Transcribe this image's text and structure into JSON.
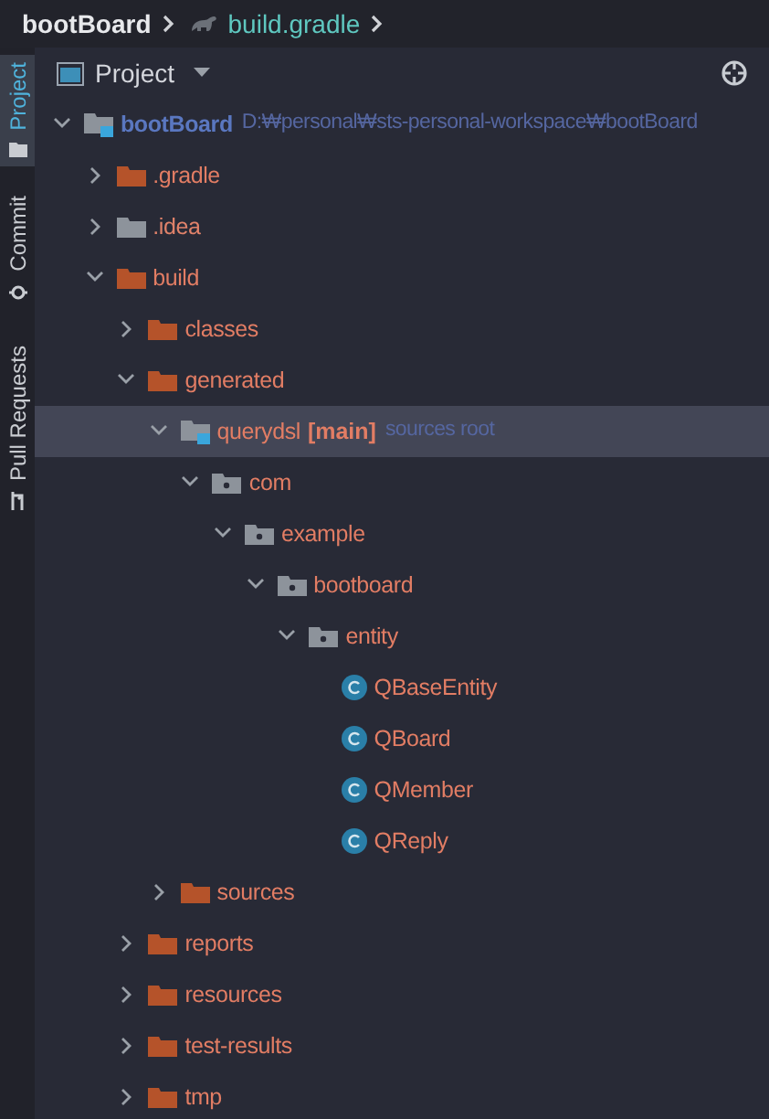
{
  "breadcrumbs": [
    {
      "label": "bootBoard",
      "kind": "project"
    },
    {
      "label": "build.gradle",
      "kind": "gradle"
    }
  ],
  "side_tabs": [
    {
      "label": "Project",
      "kind": "folder",
      "selected": true
    },
    {
      "label": "Commit",
      "kind": "commit",
      "selected": false
    },
    {
      "label": "Pull Requests",
      "kind": "pull",
      "selected": false
    }
  ],
  "panel": {
    "title": "Project"
  },
  "tree": [
    {
      "label": "bootBoard",
      "hint": "D:₩personal₩sts-personal-workspace₩bootBoard",
      "kind": "module",
      "expanded": true,
      "selected": false,
      "children": [
        {
          "label": ".gradle",
          "kind": "excluded",
          "expanded": false,
          "selected": false
        },
        {
          "label": ".idea",
          "kind": "folder",
          "expanded": false,
          "selected": false
        },
        {
          "label": "build",
          "kind": "excluded",
          "expanded": true,
          "selected": false,
          "children": [
            {
              "label": "classes",
              "kind": "excluded",
              "expanded": false,
              "selected": false
            },
            {
              "label": "generated",
              "kind": "excluded",
              "expanded": true,
              "selected": false,
              "children": [
                {
                  "label": "querydsl",
                  "tag": "[main]",
                  "hint": "sources root",
                  "kind": "source-root",
                  "expanded": true,
                  "selected": true,
                  "children": [
                    {
                      "label": "com",
                      "kind": "package",
                      "expanded": true,
                      "selected": false,
                      "children": [
                        {
                          "label": "example",
                          "kind": "package",
                          "expanded": true,
                          "selected": false,
                          "children": [
                            {
                              "label": "bootboard",
                              "kind": "package",
                              "expanded": true,
                              "selected": false,
                              "children": [
                                {
                                  "label": "entity",
                                  "kind": "package",
                                  "expanded": true,
                                  "selected": false,
                                  "children": [
                                    {
                                      "label": "QBaseEntity",
                                      "kind": "class",
                                      "selected": false
                                    },
                                    {
                                      "label": "QBoard",
                                      "kind": "class",
                                      "selected": false
                                    },
                                    {
                                      "label": "QMember",
                                      "kind": "class",
                                      "selected": false
                                    },
                                    {
                                      "label": "QReply",
                                      "kind": "class",
                                      "selected": false
                                    }
                                  ]
                                }
                              ]
                            }
                          ]
                        }
                      ]
                    }
                  ]
                },
                {
                  "label": "sources",
                  "kind": "excluded",
                  "expanded": false,
                  "selected": false
                }
              ]
            },
            {
              "label": "reports",
              "kind": "excluded",
              "expanded": false,
              "selected": false
            },
            {
              "label": "resources",
              "kind": "excluded",
              "expanded": false,
              "selected": false
            },
            {
              "label": "test-results",
              "kind": "excluded",
              "expanded": false,
              "selected": false
            },
            {
              "label": "tmp",
              "kind": "excluded",
              "expanded": false,
              "selected": false
            }
          ]
        }
      ]
    }
  ]
}
